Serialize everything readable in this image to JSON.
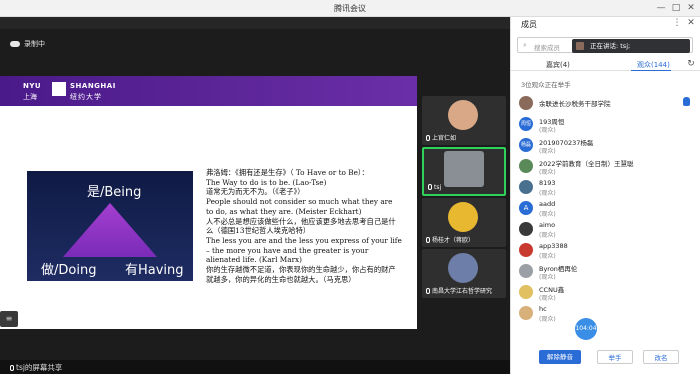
{
  "window": {
    "title": "腾讯会议",
    "minimize": "—",
    "maximize": "□",
    "close": "✕"
  },
  "meeting": {
    "recording_label": "录制中",
    "share_label": "tsj的屏幕共享",
    "menu_icon": "≡"
  },
  "slide": {
    "brand_nyu": "NYU",
    "brand_nyu_cn": "上海",
    "brand_shanghai": "SHANGHAI",
    "brand_shanghai_cn": "纽约大学",
    "pyramid_top": "是/Being",
    "pyramid_left": "做/Doing",
    "pyramid_right": "有Having",
    "quote_lines": [
      "弗洛姆：《拥有还是生存》（ To Have or to Be）：",
      "The Way to do is to be. (Lao-Tse)",
      "道常无为而无不为。（《老子》）",
      "People should not consider so much what they are to do, as what they are. (Meister Eckhart)",
      "人不必总是想应该做些什么，他应该更多地去思考自己是什么（德国13世纪哲人埃克哈特）",
      "The less you are and the less you express of your life – the more you have and the greater is your alienated life. (Karl Marx)",
      "你的生存越微不足道，你表现你的生命越少，你占有的财产就越多，你的异化的生命也就越大。（马克思）"
    ]
  },
  "video_tiles": [
    {
      "name": "上官仁如",
      "color": "#d9a987",
      "active": false
    },
    {
      "name": "tsj",
      "color": "#8a8f96",
      "active": true
    },
    {
      "name": "杨桂才（蒋欧）",
      "color": "#e8b830",
      "active": false
    },
    {
      "name": "南昌大学江右哲学研究",
      "color": "#6d7fa8",
      "active": false
    }
  ],
  "panel": {
    "title": "成员",
    "search_placeholder": "搜索成员",
    "speaking": "正在讲话: tsj;",
    "tab_guests": "嘉宾(4)",
    "tab_audience": "观众(144)",
    "waiting_text": "3位观众正在举手",
    "members": [
      {
        "name": "余联进长沙税务干部学院",
        "role": "",
        "avatar": "",
        "color": "#8a6a5a",
        "hand": true
      },
      {
        "name": "193周恒",
        "role": "(观众)",
        "avatar": "周恒",
        "color": "#2a6cd6",
        "hand": false
      },
      {
        "name": "2019070237杨磊",
        "role": "(观众)",
        "avatar": "杨磊",
        "color": "#2a6cd6",
        "hand": false
      },
      {
        "name": "2022学前教育（全日制）王慧聪",
        "role": "(观众)",
        "avatar": "",
        "color": "#5a8a5a",
        "hand": false
      },
      {
        "name": "8193",
        "role": "(观众)",
        "avatar": "",
        "color": "#4a7090",
        "hand": false
      },
      {
        "name": "aadd",
        "role": "(观众)",
        "avatar": "A",
        "color": "#2a6cd6",
        "hand": false
      },
      {
        "name": "aimo",
        "role": "(观众)",
        "avatar": "",
        "color": "#3a3a3a",
        "hand": false
      },
      {
        "name": "app3388",
        "role": "(观众)",
        "avatar": "",
        "color": "#c8392f",
        "hand": false
      },
      {
        "name": "Byron栖再伦",
        "role": "(观众)",
        "avatar": "",
        "color": "#9aa0a6",
        "hand": false
      },
      {
        "name": "CCNU鑫",
        "role": "(观众)",
        "avatar": "",
        "color": "#e0c060",
        "hand": false
      },
      {
        "name": "hc",
        "role": "(观众)",
        "avatar": "",
        "color": "#d8b07a",
        "hand": false
      }
    ],
    "timer": "104:04",
    "btn_unmute_all": "解除静音",
    "btn_raise": "举手",
    "btn_rename": "改名"
  }
}
